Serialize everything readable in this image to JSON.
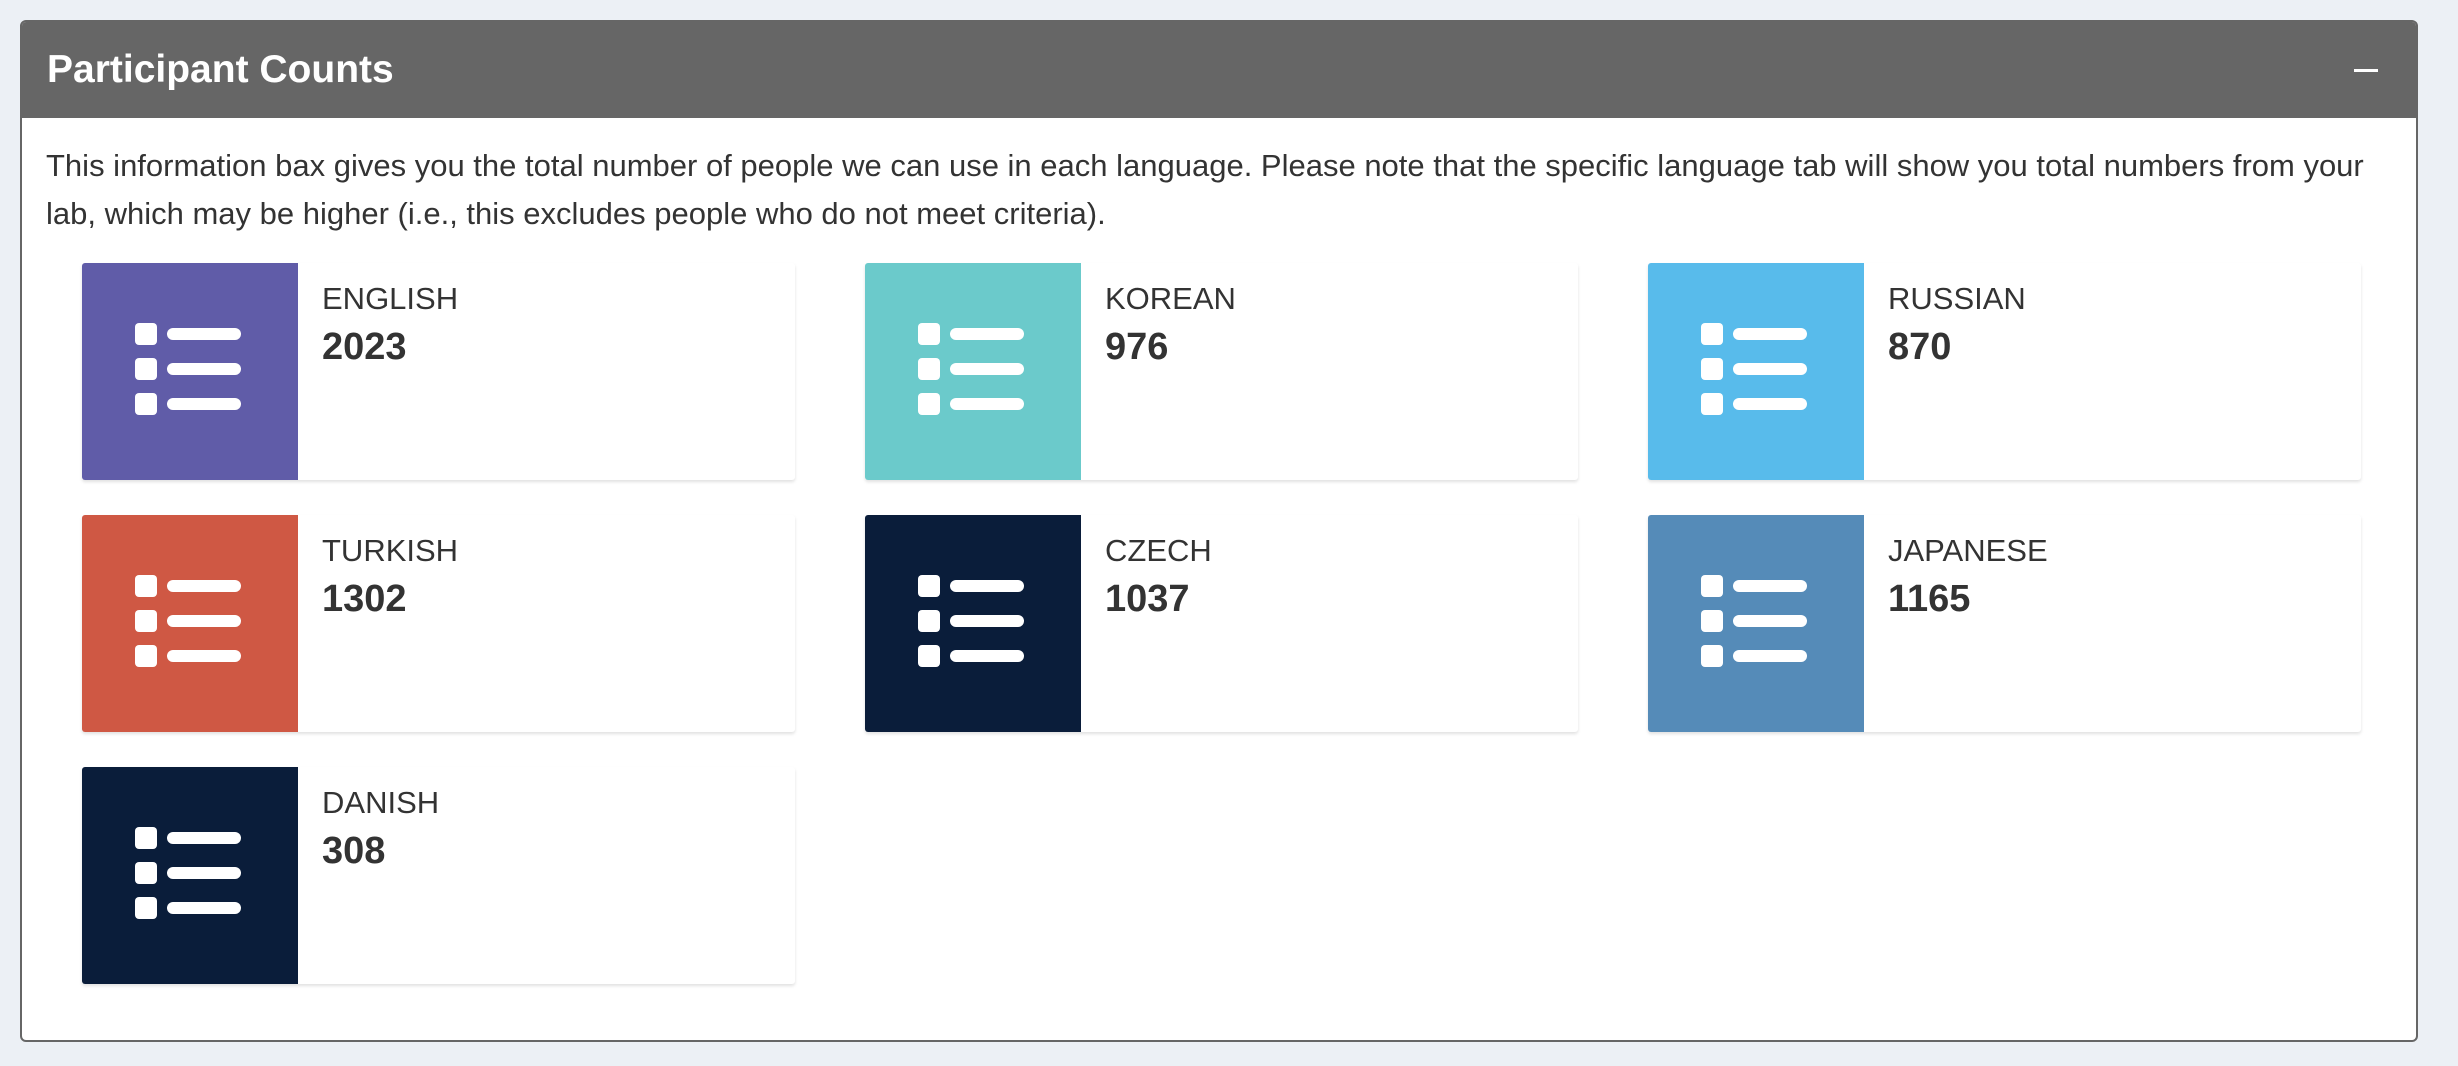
{
  "panel": {
    "title": "Participant Counts",
    "collapse_icon": "minus-icon",
    "description": "This information bax gives you the total number of people we can use in each language. Please note that the specific language tab will show you total numbers from your lab, which may be higher (i.e., this excludes people who do not meet criteria)."
  },
  "languages": [
    {
      "label": "ENGLISH",
      "count": "2023",
      "color": "#605ca8",
      "icon": "list-icon"
    },
    {
      "label": "KOREAN",
      "count": "976",
      "color": "#6bcacb",
      "icon": "list-icon"
    },
    {
      "label": "RUSSIAN",
      "count": "870",
      "color": "#58bbeb",
      "icon": "list-icon"
    },
    {
      "label": "TURKISH",
      "count": "1302",
      "color": "#cf5844",
      "icon": "list-icon"
    },
    {
      "label": "CZECH",
      "count": "1037",
      "color": "#0a1d3a",
      "icon": "list-icon"
    },
    {
      "label": "JAPANESE",
      "count": "1165",
      "color": "#558bb8",
      "icon": "list-icon"
    },
    {
      "label": "DANISH",
      "count": "308",
      "color": "#0a1d3a",
      "icon": "list-icon"
    }
  ]
}
